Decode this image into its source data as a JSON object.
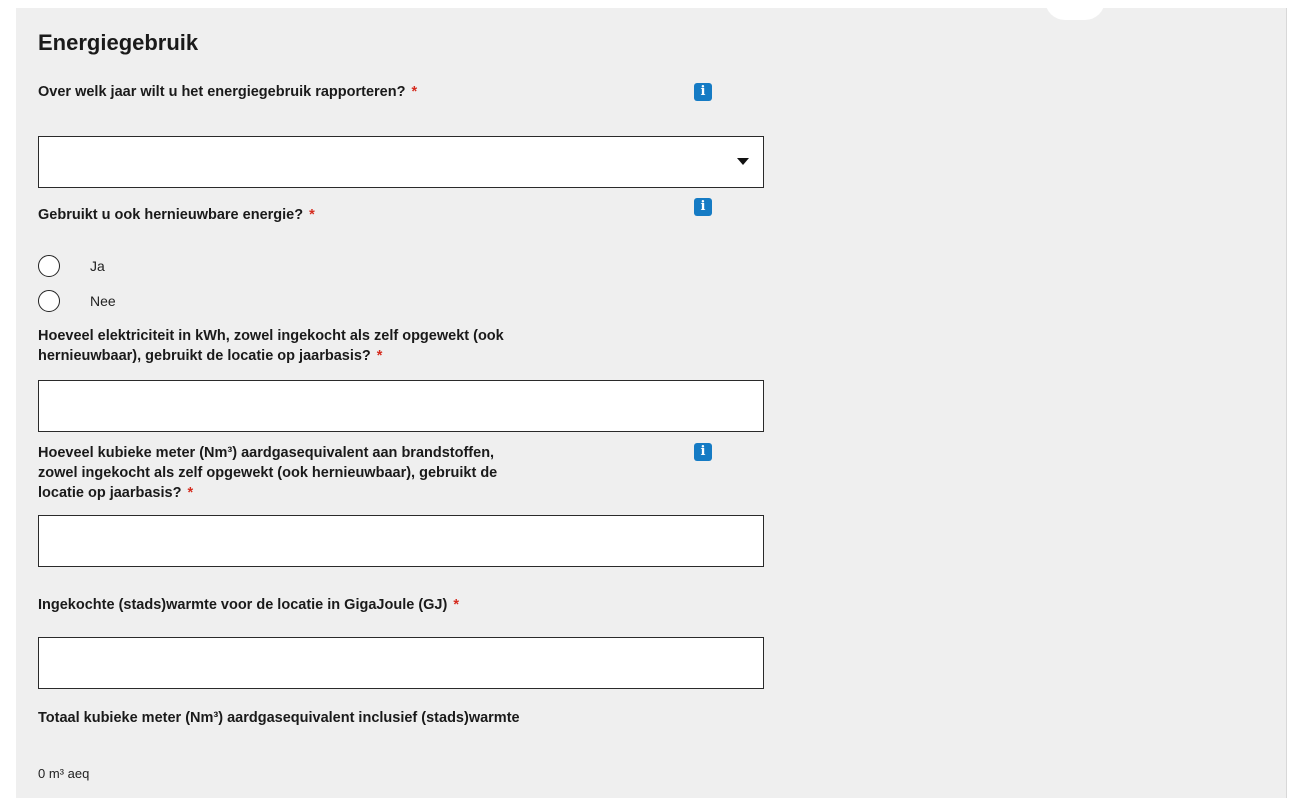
{
  "section": {
    "title": "Energiegebruik"
  },
  "questions": {
    "year": {
      "label": "Over welk jaar wilt u het energiegebruik rapporteren?",
      "required": "*",
      "info": "i",
      "selected_value": ""
    },
    "renewable": {
      "label": "Gebruikt u ook hernieuwbare energie?",
      "required": "*",
      "info": "i",
      "options": [
        "Ja",
        "Nee"
      ]
    },
    "electricity": {
      "label_line1": "Hoeveel elektriciteit in kWh, zowel ingekocht als zelf opgewekt (ook",
      "label_line2": "hernieuwbaar), gebruikt de locatie op jaarbasis?",
      "required": "*",
      "value": ""
    },
    "gas": {
      "label_line1": "Hoeveel kubieke meter (Nm³) aardgasequivalent aan brandstoffen,",
      "label_line2": "zowel ingekocht als zelf opgewekt (ook hernieuwbaar), gebruikt de",
      "label_line3": "locatie op jaarbasis?",
      "required": "*",
      "info": "i",
      "value": ""
    },
    "heat": {
      "label": "Ingekochte (stads)warmte voor de locatie in GigaJoule (GJ)",
      "required": "*",
      "value": ""
    },
    "total": {
      "label": "Totaal kubieke meter (Nm³) aardgasequivalent inclusief (stads)warmte",
      "value": "0 m³ aeq"
    }
  }
}
